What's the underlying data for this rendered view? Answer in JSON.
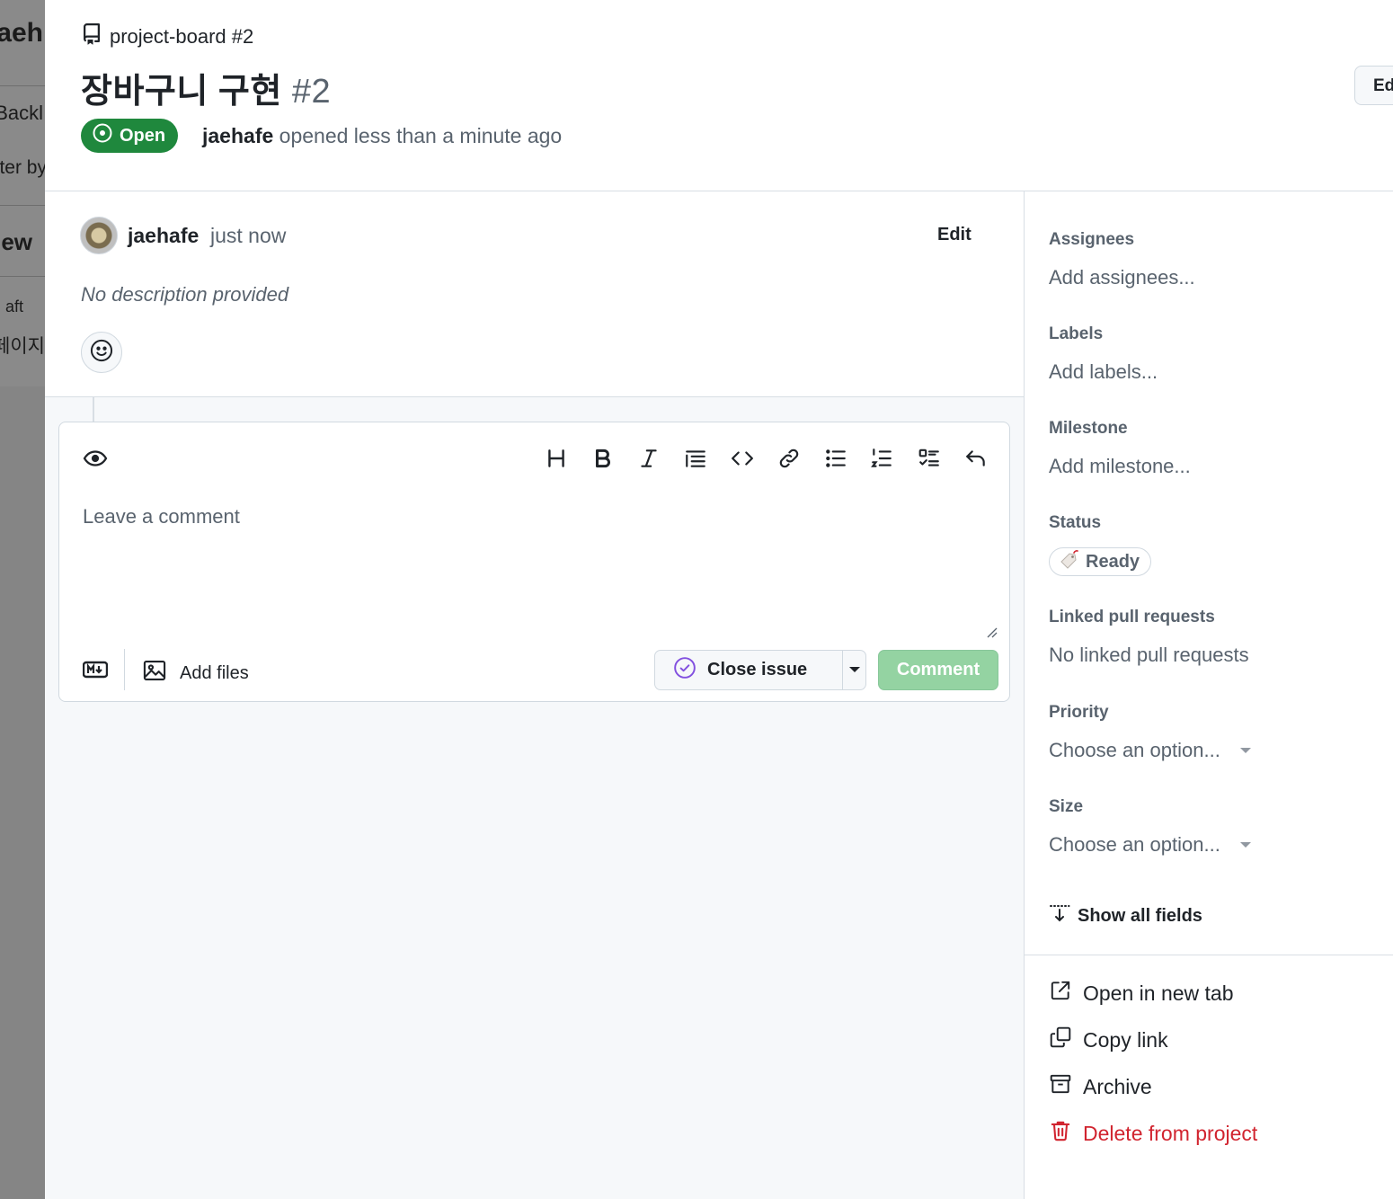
{
  "background": {
    "texts": [
      "aeh",
      "Backl",
      "ter by",
      "ew",
      "aft",
      "페이지"
    ]
  },
  "header": {
    "breadcrumb": "project-board #2",
    "title": "장바구니 구현",
    "issue_number": "#2",
    "edit_label": "Ed",
    "state": "Open",
    "author": "jaehafe",
    "opened_text": "opened less than a minute ago"
  },
  "comment": {
    "author": "jaehafe",
    "time": "just now",
    "edit_label": "Edit",
    "description": "No description provided"
  },
  "editor": {
    "placeholder": "Leave a comment",
    "add_files_label": "Add files",
    "close_issue_label": "Close issue",
    "comment_label": "Comment",
    "toolbar_icons": [
      "heading-icon",
      "bold-icon",
      "italic-icon",
      "quote-icon",
      "code-icon",
      "link-icon",
      "bulleted-list-icon",
      "numbered-list-icon",
      "task-list-icon",
      "undo-icon"
    ]
  },
  "sidebar": {
    "assignees": {
      "label": "Assignees",
      "value": "Add assignees..."
    },
    "labels": {
      "label": "Labels",
      "value": "Add labels..."
    },
    "milestone": {
      "label": "Milestone",
      "value": "Add milestone..."
    },
    "status": {
      "label": "Status",
      "value": "Ready"
    },
    "linked_prs": {
      "label": "Linked pull requests",
      "value": "No linked pull requests"
    },
    "priority": {
      "label": "Priority",
      "value": "Choose an option..."
    },
    "size": {
      "label": "Size",
      "value": "Choose an option..."
    },
    "show_all_fields": "Show all fields",
    "actions": {
      "open_new_tab": "Open in new tab",
      "copy_link": "Copy link",
      "archive": "Archive",
      "delete": "Delete from project"
    }
  },
  "colors": {
    "open_green": "#1f883d",
    "comment_disabled": "#94d3a2",
    "danger": "#d1242f",
    "muted": "#59636e"
  }
}
